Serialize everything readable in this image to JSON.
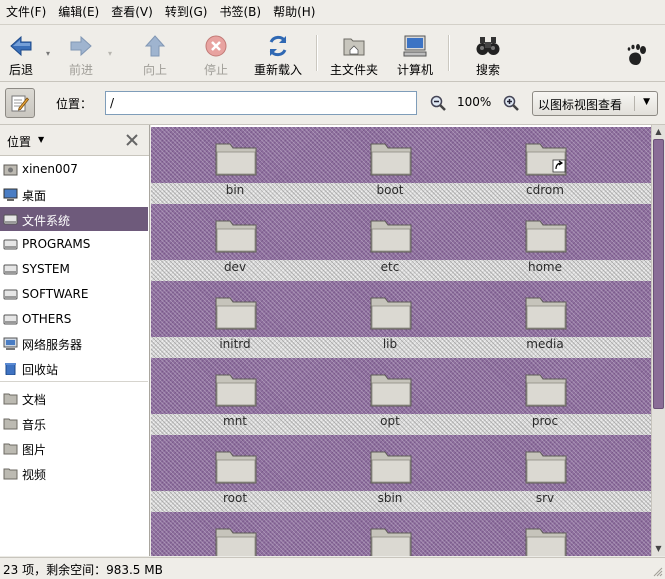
{
  "menubar": {
    "items": [
      "文件(F)",
      "编辑(E)",
      "查看(V)",
      "转到(G)",
      "书签(B)",
      "帮助(H)"
    ]
  },
  "toolbar": {
    "back": {
      "label": "后退",
      "icon": "arrow-left-icon",
      "enabled": true
    },
    "forward": {
      "label": "前进",
      "icon": "arrow-right-icon",
      "enabled": false
    },
    "up": {
      "label": "向上",
      "icon": "arrow-up-icon",
      "enabled": false
    },
    "stop": {
      "label": "停止",
      "icon": "stop-icon",
      "enabled": false
    },
    "reload": {
      "label": "重新载入",
      "icon": "reload-icon",
      "enabled": true
    },
    "home": {
      "label": "主文件夹",
      "icon": "home-folder-icon",
      "enabled": true
    },
    "computer": {
      "label": "计算机",
      "icon": "computer-icon",
      "enabled": true
    },
    "search": {
      "label": "搜索",
      "icon": "binoculars-icon",
      "enabled": true
    },
    "brand_icon": "gnome-foot-icon"
  },
  "locationbar": {
    "label": "位置：",
    "path": "/",
    "zoom": "100%",
    "view_mode": "以图标视图查看"
  },
  "sidebar": {
    "title": "位置",
    "items": [
      {
        "label": "xinen007",
        "icon": "home-icon"
      },
      {
        "label": "桌面",
        "icon": "desktop-icon"
      },
      {
        "label": "文件系统",
        "icon": "drive-icon",
        "selected": true
      },
      {
        "label": "PROGRAMS",
        "icon": "drive-icon"
      },
      {
        "label": "SYSTEM",
        "icon": "drive-icon"
      },
      {
        "label": "SOFTWARE",
        "icon": "drive-icon"
      },
      {
        "label": "OTHERS",
        "icon": "drive-icon"
      },
      {
        "label": "网络服务器",
        "icon": "network-icon"
      },
      {
        "label": "回收站",
        "icon": "trash-icon"
      },
      {
        "label": "文档",
        "icon": "folder-icon"
      },
      {
        "label": "音乐",
        "icon": "folder-icon"
      },
      {
        "label": "图片",
        "icon": "folder-icon"
      },
      {
        "label": "视频",
        "icon": "folder-icon"
      }
    ]
  },
  "files": [
    {
      "name": "bin"
    },
    {
      "name": "boot"
    },
    {
      "name": "cdrom",
      "link": true
    },
    {
      "name": "dev"
    },
    {
      "name": "etc"
    },
    {
      "name": "home"
    },
    {
      "name": "initrd"
    },
    {
      "name": "lib"
    },
    {
      "name": "media"
    },
    {
      "name": "mnt"
    },
    {
      "name": "opt"
    },
    {
      "name": "proc"
    },
    {
      "name": "root"
    },
    {
      "name": "sbin"
    },
    {
      "name": "srv"
    },
    {
      "name": ""
    },
    {
      "name": ""
    },
    {
      "name": ""
    }
  ],
  "status": {
    "text": "23 项，剩余空间：983.5 MB"
  },
  "colors": {
    "selection": "#6e5a7b",
    "background_purple": "#8e6f9e"
  }
}
